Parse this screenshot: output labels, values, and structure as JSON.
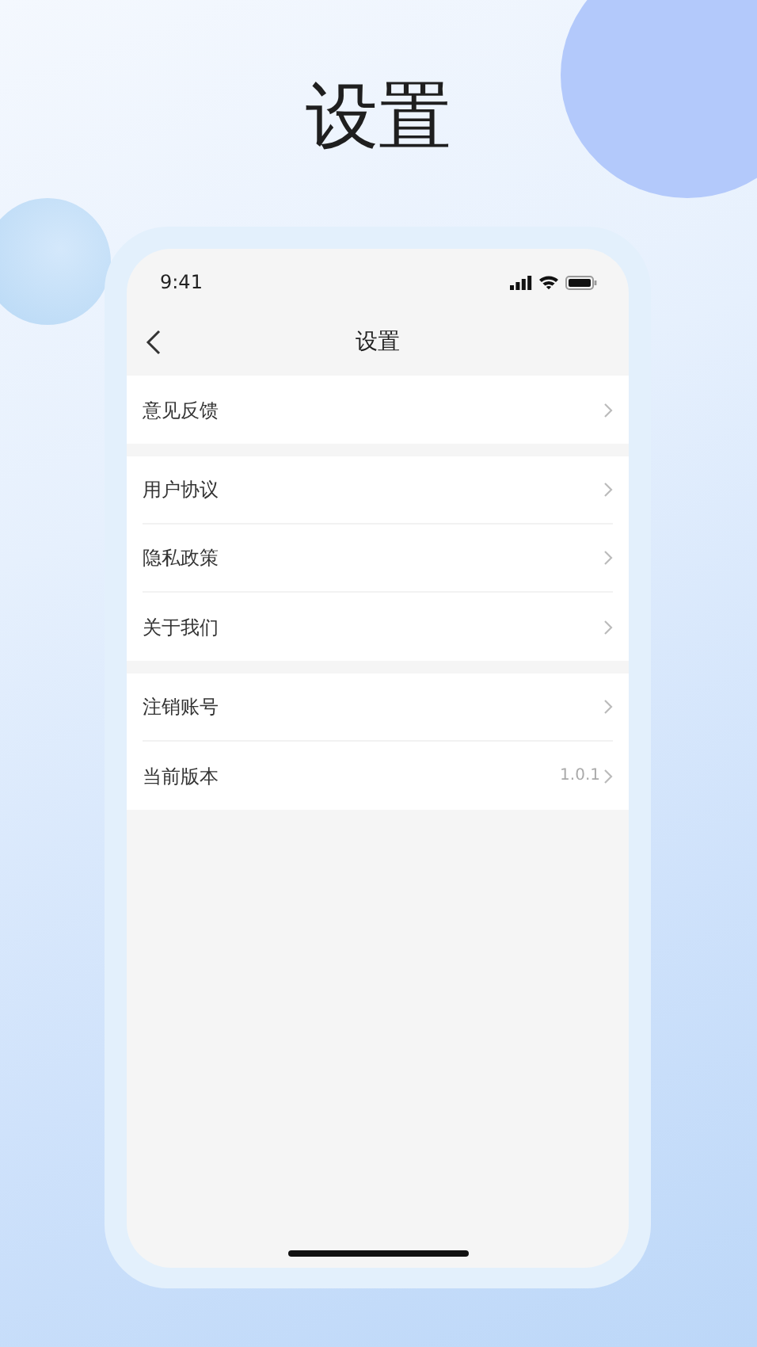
{
  "headline": "设置",
  "status_bar": {
    "time": "9:41"
  },
  "nav_bar": {
    "title": "设置"
  },
  "groups": [
    {
      "items": [
        {
          "label": "意见反馈"
        }
      ]
    },
    {
      "items": [
        {
          "label": "用户协议"
        },
        {
          "label": "隐私政策"
        },
        {
          "label": "关于我们"
        }
      ]
    },
    {
      "items": [
        {
          "label": "注销账号"
        },
        {
          "label": "当前版本",
          "value": "1.0.1"
        }
      ]
    }
  ]
}
